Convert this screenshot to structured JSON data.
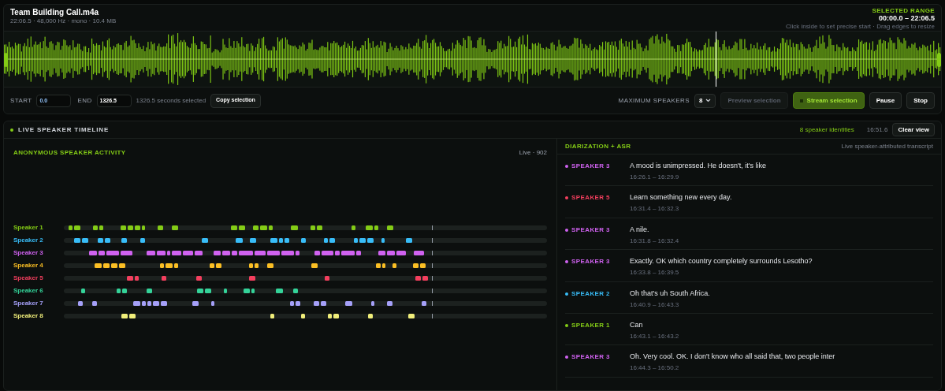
{
  "file": {
    "title": "Team Building Call.m4a",
    "meta": "22:06.5 · 48,000 Hz · mono · 10.4 MB"
  },
  "selected_range": {
    "label": "SELECTED RANGE",
    "value": "00:00.0 – 22:06.5",
    "hint": "Click inside to set precise start · Drag edges to resize"
  },
  "controls": {
    "start_label": "START",
    "start_value": "0.0",
    "end_label": "END",
    "end_value": "1326.5",
    "selected_text": "1326.5 seconds selected",
    "copy_button": "Copy selection",
    "max_speakers_label": "MAXIMUM SPEAKERS",
    "max_speakers_value": "8",
    "buttons": [
      {
        "label": "Preview selection",
        "kind": "ghost",
        "disabled": true
      },
      {
        "label": "Stream selection",
        "kind": "primary",
        "disabled": false
      },
      {
        "label": "Pause",
        "kind": "secondary",
        "disabled": false
      },
      {
        "label": "Stop",
        "kind": "secondary",
        "disabled": false
      }
    ]
  },
  "timeline": {
    "title": "LIVE SPEAKER TIMELINE",
    "identities": "8 speaker identities",
    "time": "16:51.6",
    "clear_button": "Clear view"
  },
  "activity": {
    "title": "ANONYMOUS SPEAKER ACTIVITY",
    "status": "Live · 902",
    "speakers": [
      {
        "label": "Speaker 1",
        "color": "#84cc16"
      },
      {
        "label": "Speaker 2",
        "color": "#38bdf8"
      },
      {
        "label": "Speaker 3",
        "color": "#d062f0"
      },
      {
        "label": "Speaker 4",
        "color": "#fbbf24"
      },
      {
        "label": "Speaker 5",
        "color": "#f43f5e"
      },
      {
        "label": "Speaker 6",
        "color": "#34d399"
      },
      {
        "label": "Speaker 7",
        "color": "#a5a0f8"
      },
      {
        "label": "Speaker 8",
        "color": "#f0ee7a"
      }
    ]
  },
  "transcript": {
    "title": "DIARIZATION + ASR",
    "subtitle": "Live speaker-attributed transcript",
    "entries": [
      {
        "speaker": "SPEAKER 3",
        "color": "#d062f0",
        "text": "A mood is unimpressed. He doesn't, it's like",
        "time": "16:26.1 – 16:29.9"
      },
      {
        "speaker": "SPEAKER 5",
        "color": "#f43f5e",
        "text": "Learn something new every day.",
        "time": "16:31.4 – 16:32.3"
      },
      {
        "speaker": "SPEAKER 3",
        "color": "#d062f0",
        "text": "A nile.",
        "time": "16:31.8 – 16:32.4"
      },
      {
        "speaker": "SPEAKER 3",
        "color": "#d062f0",
        "text": "Exactly. OK which country completely surrounds Lesotho?",
        "time": "16:33.8 – 16:39.5"
      },
      {
        "speaker": "SPEAKER 2",
        "color": "#38bdf8",
        "text": "Oh that's uh South Africa.",
        "time": "16:40.9 – 16:43.3"
      },
      {
        "speaker": "SPEAKER 1",
        "color": "#84cc16",
        "text": "Can",
        "time": "16:43.1 – 16:43.2"
      },
      {
        "speaker": "SPEAKER 3",
        "color": "#d062f0",
        "text": "Oh. Very cool. OK. I don't know who all said that, two people inter",
        "time": "16:44.3 – 16:50.2"
      }
    ]
  }
}
